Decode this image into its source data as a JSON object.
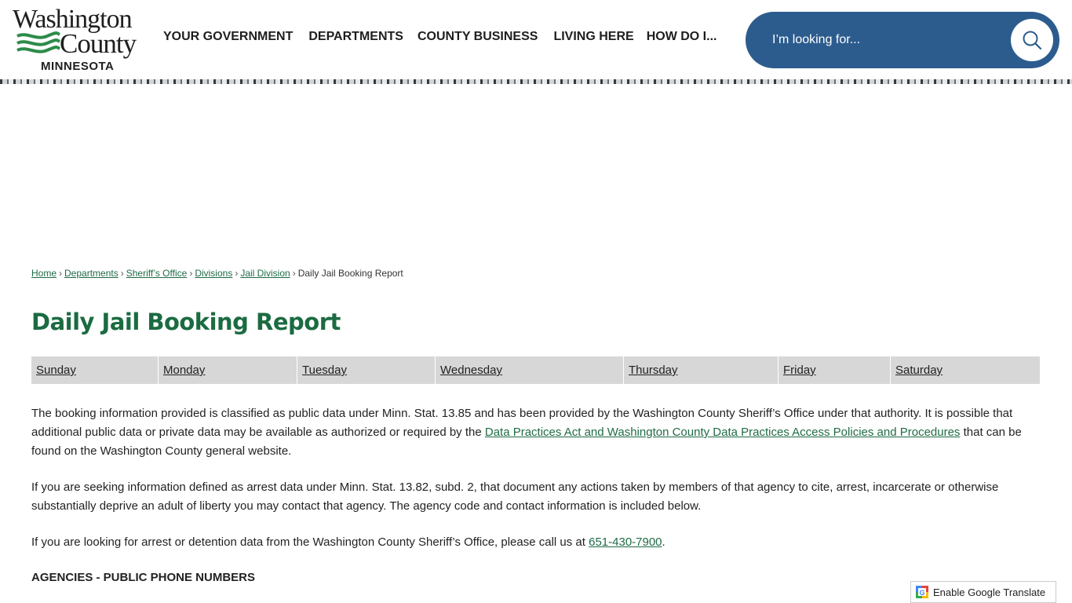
{
  "header": {
    "logo": {
      "line1": "Washington",
      "line2": "County",
      "line3": "MINNESOTA"
    },
    "nav": [
      {
        "label": "YOUR GOVERNMENT"
      },
      {
        "label": "DEPARTMENTS"
      },
      {
        "label": "COUNTY BUSINESS"
      },
      {
        "label": "LIVING HERE"
      },
      {
        "label": "HOW DO I..."
      }
    ],
    "search": {
      "placeholder": "I’m looking for...",
      "icon": "search-icon"
    }
  },
  "breadcrumb": {
    "items": [
      {
        "label": "Home",
        "link": true
      },
      {
        "label": "Departments",
        "link": true
      },
      {
        "label": "Sheriff’s Office",
        "link": true
      },
      {
        "label": "Divisions",
        "link": true
      },
      {
        "label": "Jail Division",
        "link": true
      },
      {
        "label": "Daily Jail Booking Report",
        "link": false
      }
    ],
    "separator": "›"
  },
  "page": {
    "title": "Daily Jail Booking Report",
    "days": [
      "Sunday",
      "Monday",
      "Tuesday",
      "Wednesday",
      "Thursday",
      "Friday",
      "Saturday"
    ],
    "para1_before": "The booking information provided is classified as public data under Minn. Stat. 13.85 and has been provided by the Washington County Sheriff’s Office under that authority. It is possible that additional public data or private data may be available as authorized or required by the ",
    "para1_link": "Data Practices Act and Washington County Data Practices Access Policies and Procedures",
    "para1_after": " that can be found on the Washington County general website.",
    "para2": "If you are seeking information defined as arrest data under Minn. Stat. 13.82, subd. 2, that document any actions taken by members of that agency to cite, arrest, incarcerate or otherwise substantially deprive an adult of liberty you may contact that agency. The agency code and contact information is included below.",
    "para3_before": "If you are looking for arrest or detention data from the Washington County Sheriff’s Office, please call us at ",
    "para3_link": "651-430-7900",
    "para3_after": ".",
    "agencies_heading": "AGENCIES - PUBLIC PHONE NUMBERS"
  },
  "translate": {
    "label": "Enable Google Translate"
  },
  "colors": {
    "brand_green": "#1b6b41",
    "search_blue": "#2c5c8e",
    "day_bar": "#d7d7d7"
  }
}
